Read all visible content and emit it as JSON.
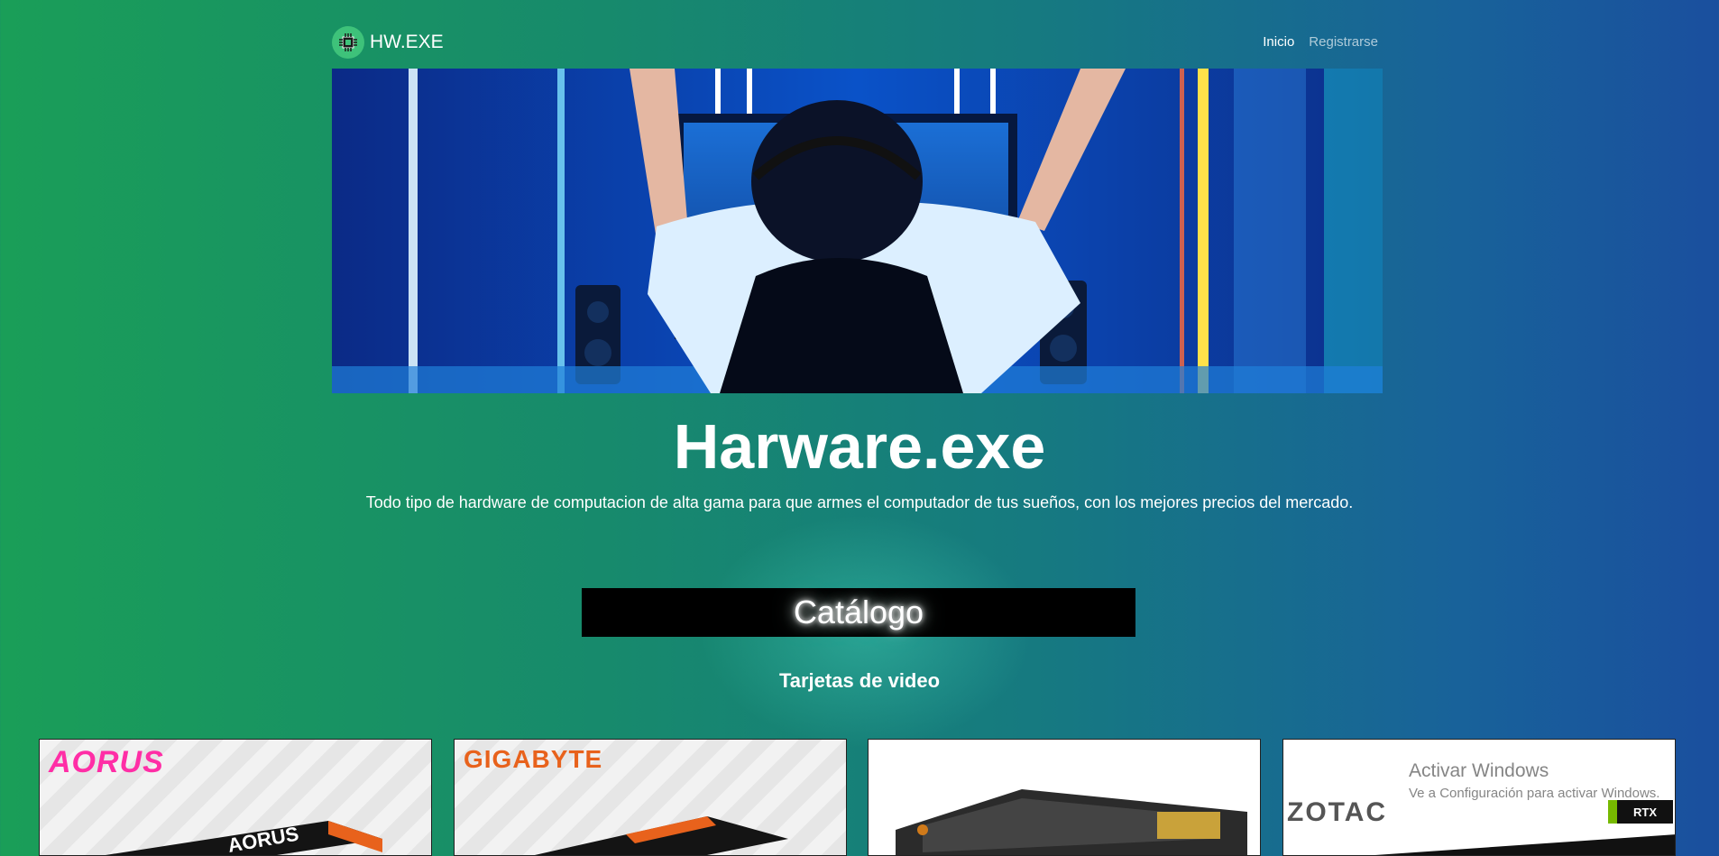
{
  "header": {
    "brand": "HW.EXE",
    "nav": [
      {
        "label": "Inicio",
        "active": true
      },
      {
        "label": "Registrarse",
        "active": false
      }
    ]
  },
  "hero": {
    "image": "gamer-celebrating-neon-room"
  },
  "main": {
    "title": "Harware.exe",
    "subtitle": "Todo tipo de hardware de computacion de alta gama para que armes el computador de tus sueños, con los mejores precios del mercado.",
    "catalog_label": "Catálogo",
    "section_title": "Tarjetas de video"
  },
  "products": [
    {
      "brand": "AORUS",
      "image": "aorus-gpu-box"
    },
    {
      "brand": "GIGABYTE",
      "image": "gigabyte-gpu-box"
    },
    {
      "brand": "",
      "image": "tuf-gaming-gpu"
    },
    {
      "brand": "ZOTAC",
      "image": "zotac-gpu-box",
      "badge": "RTX"
    }
  ],
  "overlay": {
    "title": "Activar Windows",
    "subtitle": "Ve a Configuración para activar Windows."
  },
  "colors": {
    "gradient_start": "#1a9e58",
    "gradient_end": "#1a4f9e",
    "catalog_bg": "#000000",
    "aorus_pink": "#ff2ea6",
    "gigabyte_orange": "#e8621c"
  }
}
